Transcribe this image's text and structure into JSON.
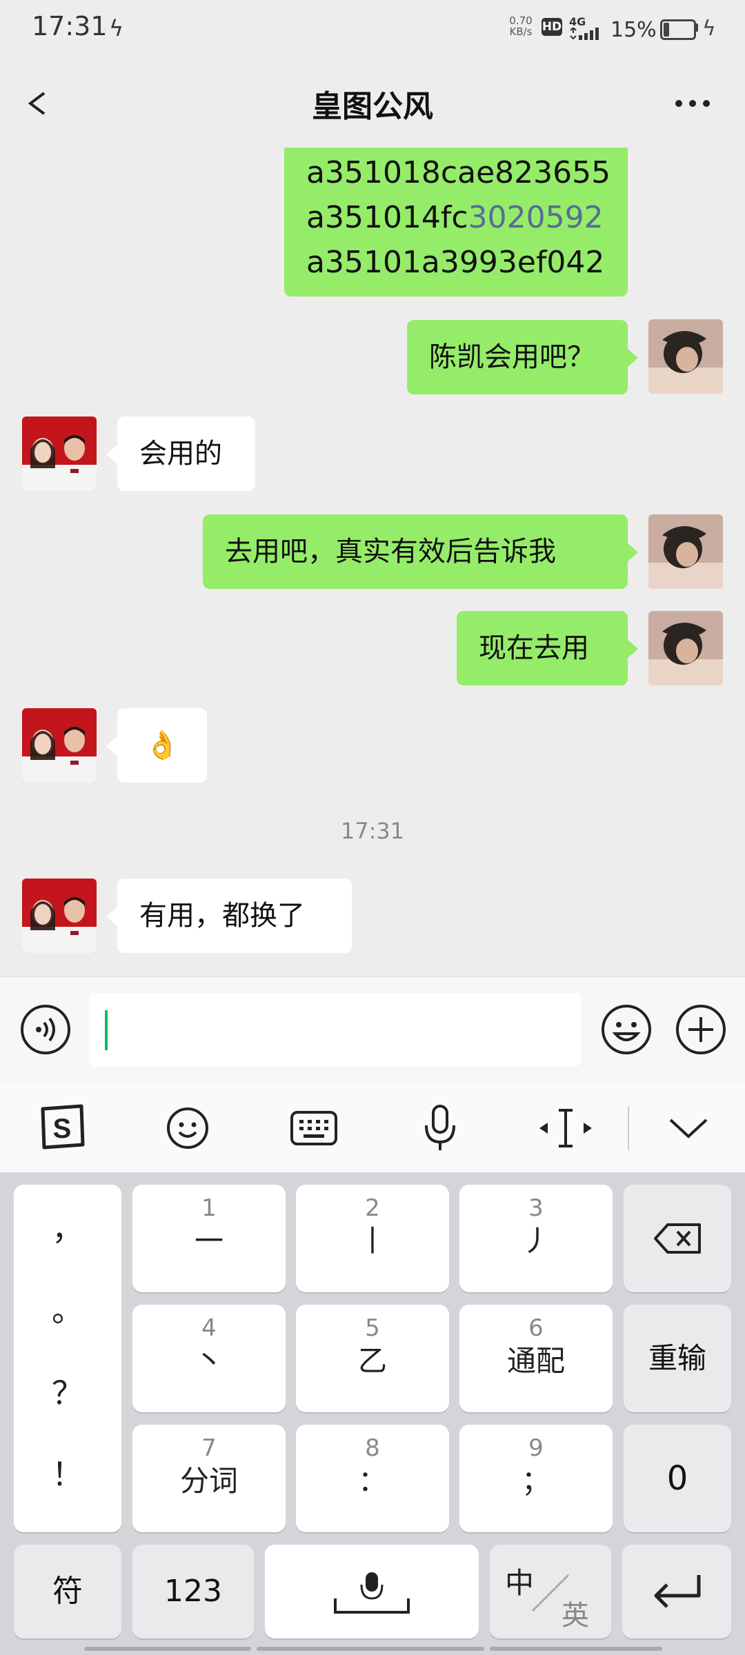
{
  "status_bar": {
    "time": "17:31",
    "speed_value": "0.70",
    "speed_unit": "KB/s",
    "hd": "HD",
    "network": "4G",
    "battery": "15%"
  },
  "header": {
    "title": "皇图公风"
  },
  "messages": {
    "codes": [
      "a351018cae823655",
      "a351014fc",
      "3020592",
      "a35101a3993ef042"
    ],
    "m1": "陈凯会用吧？",
    "m2": "会用的",
    "m3": "去用吧，真实有效后告诉我",
    "m4": "现在去用",
    "m5": "👌",
    "timestamp": "17:31",
    "m6": "有用，都换了"
  },
  "keyboard": {
    "punct": [
      "，",
      "。",
      "？",
      "！"
    ],
    "keys": [
      {
        "num": "1",
        "label": "一"
      },
      {
        "num": "2",
        "label": "丨"
      },
      {
        "num": "3",
        "label": "丿"
      },
      {
        "num": "4",
        "label": "丶"
      },
      {
        "num": "5",
        "label": "乙"
      },
      {
        "num": "6",
        "label": "通配"
      },
      {
        "num": "7",
        "label": "分词"
      },
      {
        "num": "8",
        "label": "："
      },
      {
        "num": "9",
        "label": "；"
      }
    ],
    "reenter": "重输",
    "zero": "0",
    "symbols": "符",
    "num_mode": "123",
    "lang_cn": "中",
    "lang_en": "英"
  },
  "icons": {
    "back": "chevron-left-icon",
    "more": "more-dots-icon",
    "voice": "voice-icon",
    "emoji": "emoji-icon",
    "plus": "plus-icon"
  }
}
